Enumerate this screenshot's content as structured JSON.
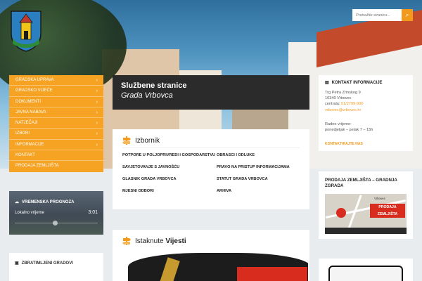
{
  "search": {
    "placeholder": "Pretražite stranicu..."
  },
  "menu": {
    "items": [
      {
        "label": "Gradska uprava",
        "has_sub": true
      },
      {
        "label": "Gradsko vijeće",
        "has_sub": true
      },
      {
        "label": "Dokumenti",
        "has_sub": true
      },
      {
        "label": "Javna nabava",
        "has_sub": true
      },
      {
        "label": "Natječaji",
        "has_sub": true
      },
      {
        "label": "Izbori",
        "has_sub": true
      },
      {
        "label": "Informacije",
        "has_sub": true
      },
      {
        "label": "Kontakt",
        "has_sub": false
      },
      {
        "label": "Prodaja zemljišta",
        "has_sub": false
      }
    ]
  },
  "weather": {
    "title": "Vremenska prognoza",
    "subtitle": "Lokalno vrijeme",
    "time": "3:01"
  },
  "twins": {
    "title": "Zbratimljeni gradovi"
  },
  "banner": {
    "line1": "Službene stranice",
    "line2": "Grada Vrbovca"
  },
  "izbornik": {
    "title": "Izbornik",
    "links": [
      "Potpore u poljoprivredi i gospodarstvu",
      "Obrasci i odluke",
      "Savjetovanje s javnošću",
      "Pravo na pristup informacijama",
      "Glasnik Grada Vrbovca",
      "Statut Grada Vrbovca",
      "Mjesni odbori",
      "Arhiva"
    ]
  },
  "vijesti": {
    "title_plain": "Istaknute ",
    "title_bold": "Vijesti"
  },
  "kontakt": {
    "title": "Kontakt informacije",
    "address1": "Trg Petra Zrinskog 9",
    "address2": "10340 Vrbovec",
    "phone_label": "centrala: ",
    "phone": "01/2799-900",
    "email": "vrbovec@vrbovec.hr",
    "hours_label": "Radno vrijeme:",
    "hours": "ponedjeljak – petak 7 – 15h",
    "more": "Kontaktirajte nas"
  },
  "prodaja": {
    "title": "Prodaja zemljišta – Gradnja zgrada",
    "map_badge": "Prodaja zemljišta",
    "map_top": "Vrbovec"
  },
  "colors": {
    "accent": "#f6a223",
    "dark": "#2b2b2b"
  }
}
